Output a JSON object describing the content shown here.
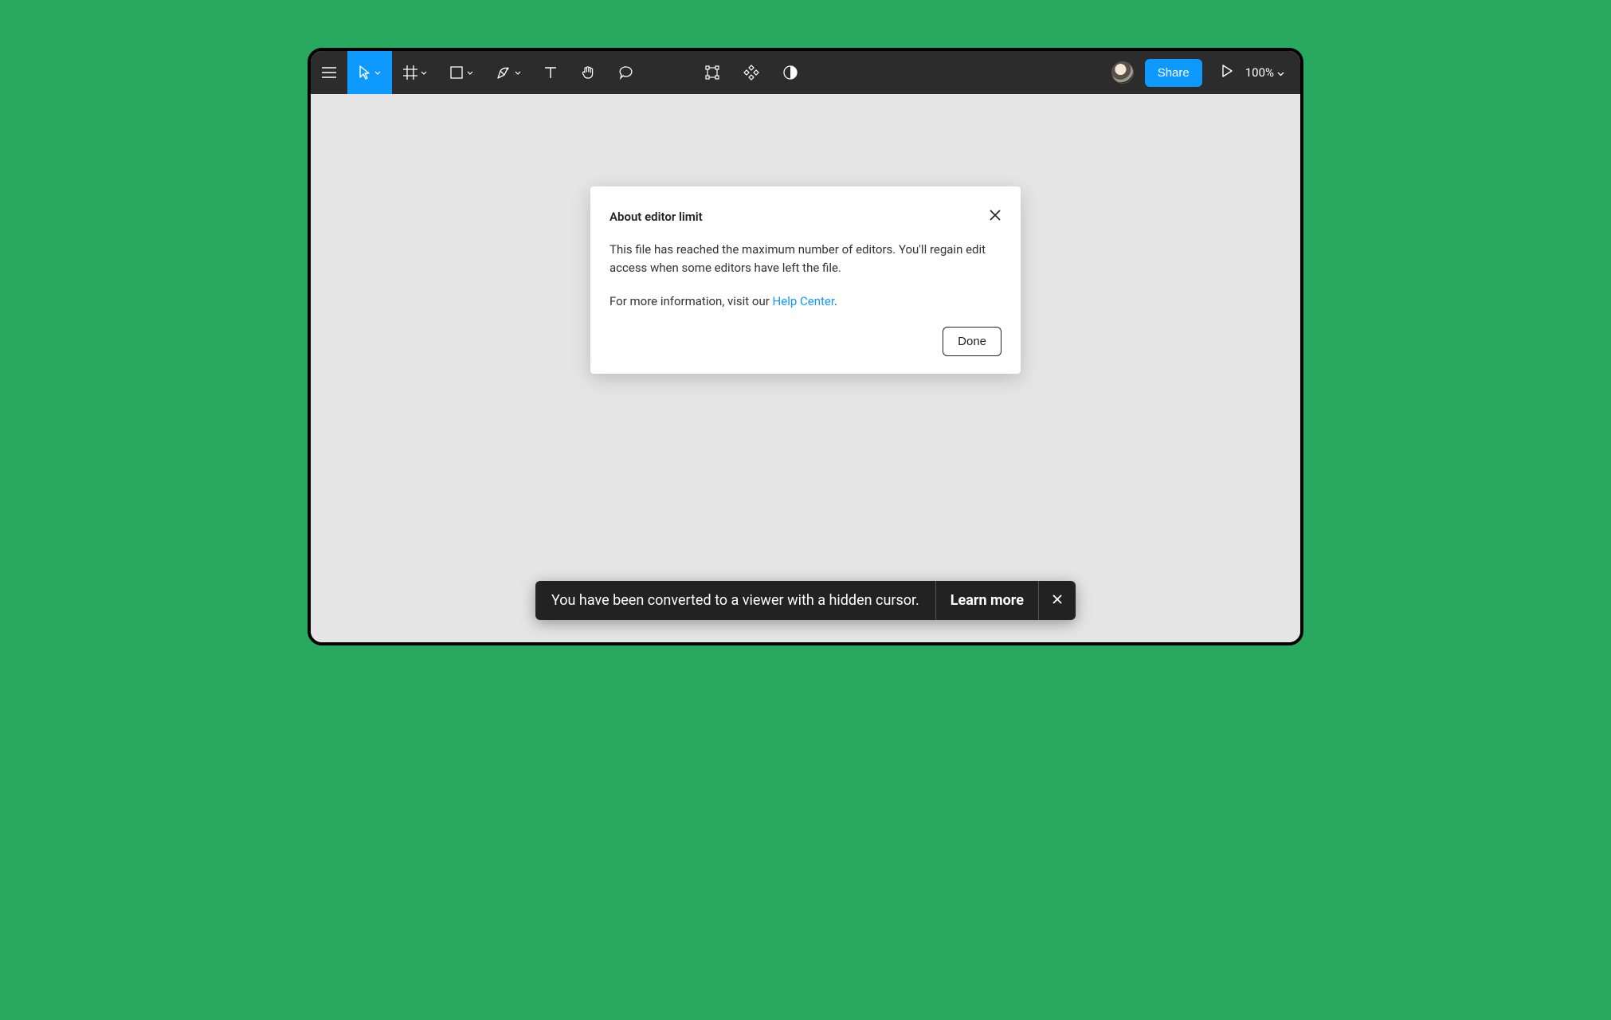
{
  "toolbar": {
    "share_label": "Share",
    "zoom_label": "100%"
  },
  "modal": {
    "title": "About editor limit",
    "body_text": "This file has reached the maximum number of editors. You'll regain edit access when some editors have left the file.",
    "more_info_prefix": "For more information, visit our ",
    "help_link_label": "Help Center",
    "more_info_suffix": ".",
    "done_label": "Done"
  },
  "toast": {
    "message": "You have been converted to a viewer with a hidden cursor.",
    "link_label": "Learn more"
  }
}
